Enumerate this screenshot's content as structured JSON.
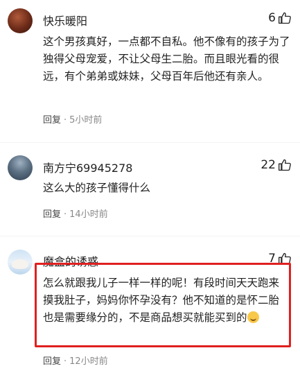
{
  "comments": [
    {
      "username": "快乐暖阳",
      "likes": "6",
      "text": "这个男孩真好，一点都不自私。他不像有的孩子为了独得父母宠爱，不让父母生二胎。而且眼光看的很远，有个弟弟或妹妹，父母百年后他还有亲人。",
      "reply_label": "回复",
      "time": "5小时前"
    },
    {
      "username": "南方宁69945278",
      "likes": "22",
      "text": "这么大的孩子懂得什么",
      "reply_label": "回复",
      "time": "14小时前"
    },
    {
      "username": "魔盒的诱惑",
      "likes": "7",
      "text": "怎么就跟我儿子一样一样的呢！有段时间天天跑来摸我肚子，妈妈你怀孕没有？他不知道的是怀二胎也是需要缘分的，不是商品想买就能买到的",
      "emoji": "sweat-smile-emoji",
      "reply_label": "回复",
      "time": "12小时前"
    }
  ],
  "colors": {
    "highlight": "#e02020",
    "meta": "#888888",
    "text": "#222222"
  }
}
